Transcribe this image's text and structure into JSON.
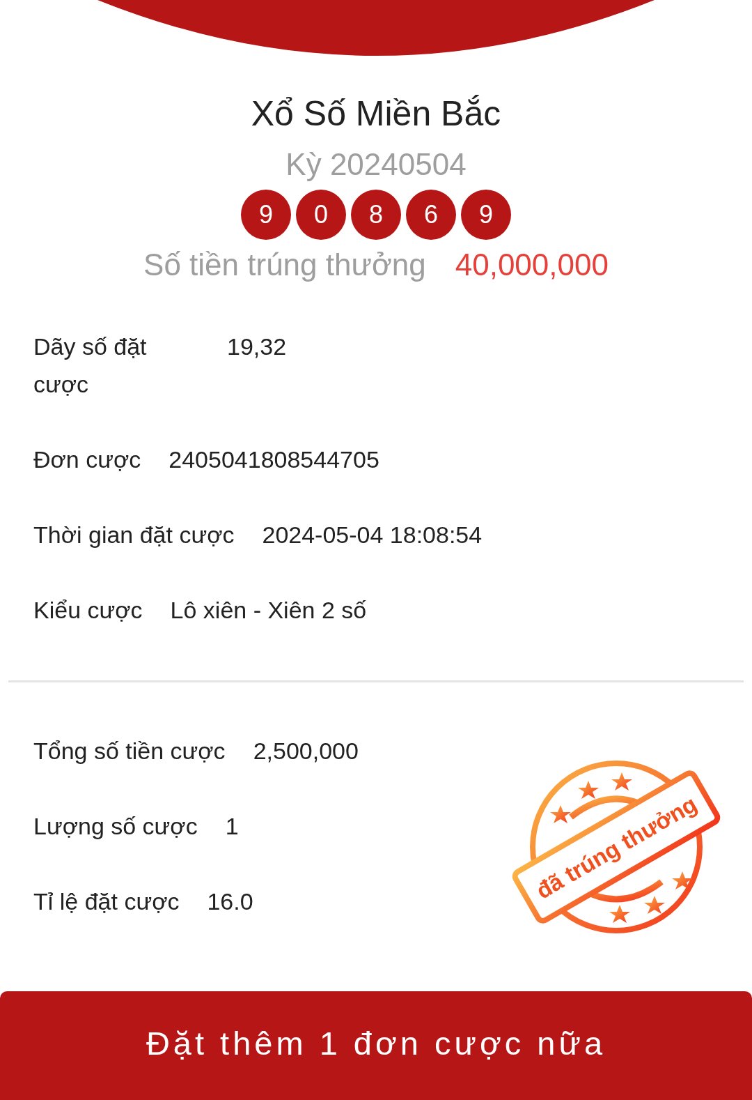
{
  "lottery": {
    "title": "Xổ Số Miền Bắc",
    "period": "Kỳ 20240504",
    "numbers": [
      "9",
      "0",
      "8",
      "6",
      "9"
    ],
    "prize_label": "Số tiền trúng thưởng",
    "prize_amount": "40,000,000"
  },
  "details": [
    {
      "label": "Dãy số đặt cược",
      "value": "19,32"
    },
    {
      "label": "Đơn cược",
      "value": "2405041808544705"
    },
    {
      "label": "Thời gian đặt cược",
      "value": "2024-05-04 18:08:54"
    },
    {
      "label": "Kiểu cược",
      "value": "Lô xiên - Xiên 2 số"
    }
  ],
  "summary": [
    {
      "label": "Tổng số tiền cược",
      "value": "2,500,000"
    },
    {
      "label": "Lượng số cược",
      "value": "1"
    },
    {
      "label": "Tỉ lệ đặt cược",
      "value": "16.0"
    }
  ],
  "stamp": {
    "text": "đã trúng thưởng"
  },
  "action_button": {
    "label": "Đặt thêm 1 đơn cược nữa"
  }
}
